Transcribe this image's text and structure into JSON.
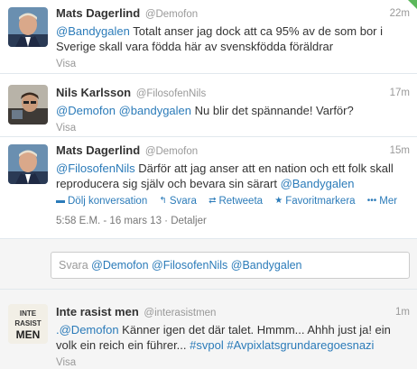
{
  "tweets": [
    {
      "fullname": "Mats Dagerlind",
      "username": "@Demofon",
      "time": "22m",
      "mention": "@Bandygalen",
      "text": " Totalt anser jag dock att ca 95% av de som bor i Sverige skall vara födda här av svenskfödda föräldrar",
      "visa": "Visa"
    },
    {
      "fullname": "Nils Karlsson",
      "username": "@FilosofenNils",
      "time": "17m",
      "mention1": "@Demofon",
      "mention2": "@bandygalen",
      "text": " Nu blir det spännande! Varför?",
      "visa": "Visa"
    },
    {
      "fullname": "Mats Dagerlind",
      "username": "@Demofon",
      "time": "15m",
      "mention1": "@FilosofenNils",
      "text": " Därför att jag anser att en nation och ett folk skall reproducera sig själv och bevara sin särart ",
      "mention2": "@Bandygalen",
      "actions": {
        "hide": "Dölj konversation",
        "reply": "Svara",
        "retweet": "Retweeta",
        "favorite": "Favoritmarkera",
        "more": "Mer"
      },
      "meta_time": "5:58 E.M. - 16 mars 13",
      "meta_details": "Detaljer"
    },
    {
      "fullname": "Inte rasist men",
      "username": "@interasistmen",
      "time": "1m",
      "mention": ".@Demofon",
      "text": " Känner igen det där talet. Hmmm... Ahhh just ja! ein volk ein reich ein führer... ",
      "hashtag1": "#svpol",
      "hashtag2": "#Avpixlatsgrundaregoesnazi",
      "visa": "Visa",
      "avatar_text": "INTE RASIST MEN"
    }
  ],
  "reply": {
    "prefix": "Svara ",
    "m1": "@Demofon",
    "m2": "@FilosofenNils",
    "m3": "@Bandygalen"
  },
  "colors": {
    "link": "#2b7bb9",
    "corner": "#5cb85c"
  }
}
